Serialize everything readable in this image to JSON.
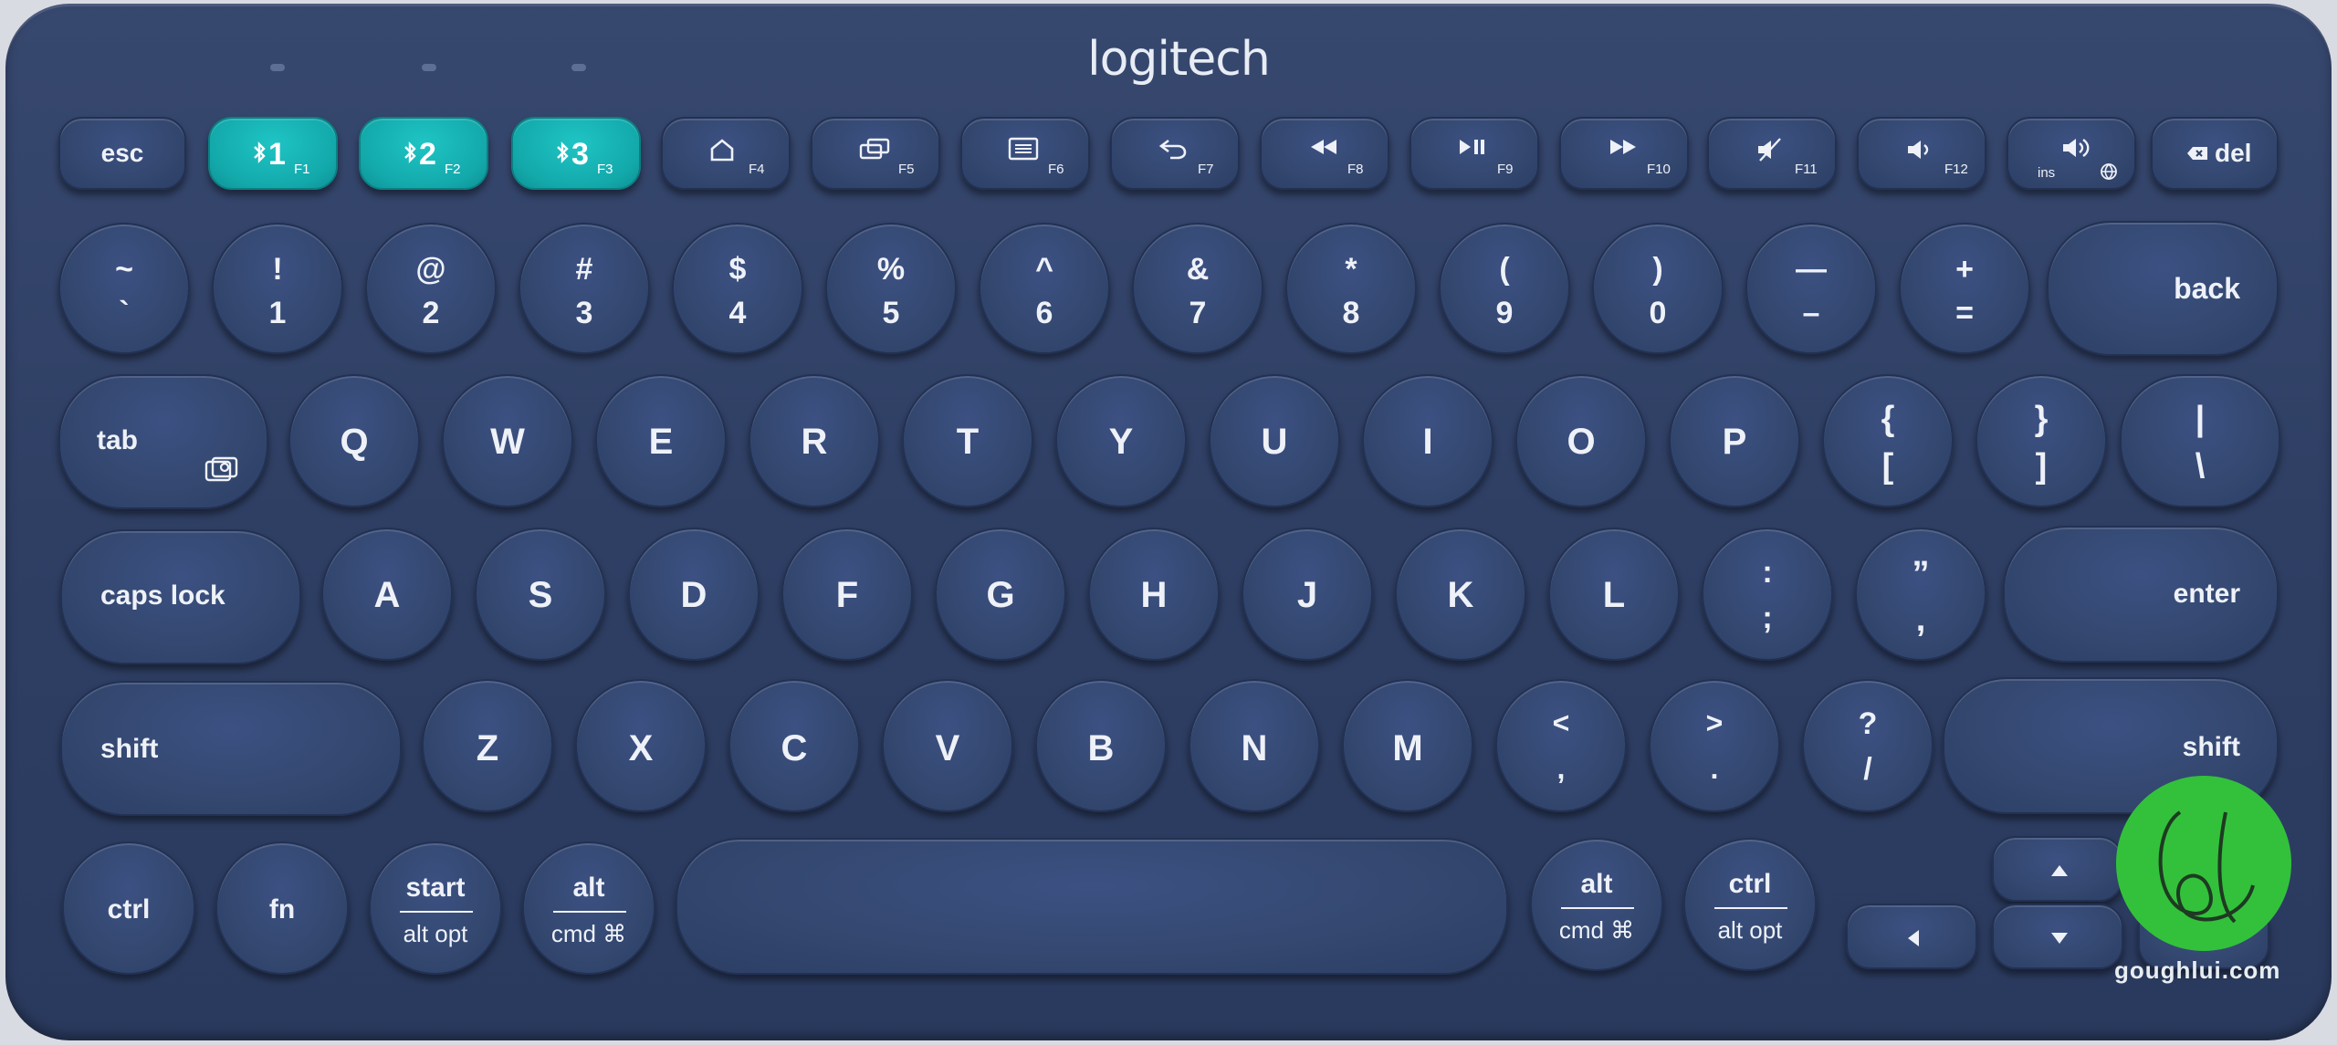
{
  "brand": "logitech",
  "watermark": "goughlui.com",
  "accent_color": "#13a9ab",
  "body_color": "#2f3f64",
  "rows": {
    "fn_row": [
      {
        "id": "esc",
        "main": "esc"
      },
      {
        "id": "f1",
        "main": "1",
        "sub": "F1",
        "icon": "bluetooth-icon",
        "accent": true
      },
      {
        "id": "f2",
        "main": "2",
        "sub": "F2",
        "icon": "bluetooth-icon",
        "accent": true
      },
      {
        "id": "f3",
        "main": "3",
        "sub": "F3",
        "icon": "bluetooth-icon",
        "accent": true
      },
      {
        "id": "f4",
        "sub": "F4",
        "icon": "home-icon"
      },
      {
        "id": "f5",
        "sub": "F5",
        "icon": "app-switch-icon"
      },
      {
        "id": "f6",
        "sub": "F6",
        "icon": "menu-icon"
      },
      {
        "id": "f7",
        "sub": "F7",
        "icon": "back-arrow-icon"
      },
      {
        "id": "f8",
        "sub": "F8",
        "icon": "rewind-icon"
      },
      {
        "id": "f9",
        "sub": "F9",
        "icon": "play-pause-icon"
      },
      {
        "id": "f10",
        "sub": "F10",
        "icon": "fast-forward-icon"
      },
      {
        "id": "f11",
        "sub": "F11",
        "icon": "mute-icon"
      },
      {
        "id": "f12",
        "sub": "F12",
        "icon": "volume-down-icon"
      },
      {
        "id": "ins",
        "sub": "ins",
        "icon": "volume-up-icon"
      },
      {
        "id": "del",
        "main": "del",
        "icon": "delete-icon"
      }
    ],
    "number_row": [
      {
        "top": "~",
        "bottom": "`"
      },
      {
        "top": "!",
        "bottom": "1"
      },
      {
        "top": "@",
        "bottom": "2"
      },
      {
        "top": "#",
        "bottom": "3"
      },
      {
        "top": "$",
        "bottom": "4"
      },
      {
        "top": "%",
        "bottom": "5"
      },
      {
        "top": "^",
        "bottom": "6"
      },
      {
        "top": "&",
        "bottom": "7"
      },
      {
        "top": "*",
        "bottom": "8"
      },
      {
        "top": "(",
        "bottom": "9"
      },
      {
        "top": ")",
        "bottom": "0"
      },
      {
        "top": "—",
        "bottom": "–"
      },
      {
        "top": "+",
        "bottom": "="
      }
    ],
    "back": "back",
    "tab": "tab",
    "qwerty": [
      "Q",
      "W",
      "E",
      "R",
      "T",
      "Y",
      "U",
      "I",
      "O",
      "P"
    ],
    "brackets": [
      {
        "top": "{",
        "bottom": "["
      },
      {
        "top": "}",
        "bottom": "]"
      },
      {
        "top": "|",
        "bottom": "\\"
      }
    ],
    "caps": "caps lock",
    "asdf": [
      "A",
      "S",
      "D",
      "F",
      "G",
      "H",
      "J",
      "K",
      "L"
    ],
    "semicolon": {
      "top": ":",
      "bottom": ";"
    },
    "quote": {
      "top": "”",
      "bottom": ","
    },
    "enter": "enter",
    "shift": "shift",
    "zxcv": [
      "Z",
      "X",
      "C",
      "V",
      "B",
      "N",
      "M"
    ],
    "comma": {
      "top": "<",
      "bottom": ","
    },
    "period": {
      "top": ">",
      "bottom": "."
    },
    "slash": {
      "top": "?",
      "bottom": "/"
    },
    "ctrl": "ctrl",
    "fn": "fn",
    "start": {
      "top": "start",
      "bottom": "alt opt"
    },
    "alt_left": {
      "top": "alt",
      "bottom": "cmd ⌘"
    },
    "alt_right": {
      "top": "alt",
      "bottom": "cmd ⌘"
    },
    "ctrl_right": {
      "top": "ctrl",
      "bottom": "alt opt"
    }
  }
}
